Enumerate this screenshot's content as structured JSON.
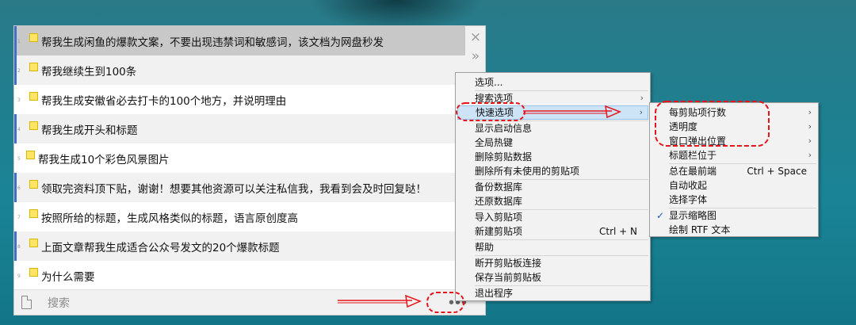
{
  "clip_items": [
    {
      "index": "1",
      "text": "帮我生成闲鱼的爆款文案，不要出现违禁词和敏感词，该文档为网盘秒发"
    },
    {
      "index": "2",
      "text": "帮我继续生到100条"
    },
    {
      "index": "3",
      "text": "帮我生成安徽省必去打卡的100个地方，并说明理由"
    },
    {
      "index": "4",
      "text": "帮我生成开头和标题"
    },
    {
      "index": "5",
      "text": "帮我生成10个彩色风景图片"
    },
    {
      "index": "6",
      "text": "领取完资料顶下贴，谢谢！想要其他资源可以关注私信我，我看到会及时回复哒！"
    },
    {
      "index": "7",
      "text": "按照所给的标题，生成风格类似的标题，语言原创度高"
    },
    {
      "index": "8",
      "text": "上面文章帮我生成适合公众号发文的20个爆款标题"
    },
    {
      "index": "9",
      "text": "为什么需要"
    }
  ],
  "panel_icons": {
    "close": "×",
    "expand": "»",
    "more": "•••"
  },
  "search": {
    "placeholder": "搜索"
  },
  "main_menu": {
    "options": "选项...",
    "search_options": "搜索选项",
    "quick_options": "快速选项",
    "show_startup": "显示启动信息",
    "global_hotkey": "全局热键",
    "delete_clip": "删除剪贴数据",
    "delete_unused": "删除所有未使用的剪贴项",
    "backup_db": "备份数据库",
    "restore_db": "还原数据库",
    "import_clip": "导入剪贴项",
    "new_clip": "新建剪贴项",
    "new_clip_shortcut": "Ctrl + N",
    "help": "帮助",
    "disconnect": "断开剪贴板连接",
    "save_current": "保存当前剪贴板",
    "exit": "退出程序"
  },
  "submenu": {
    "lines_per_clip": "每剪贴项行数",
    "transparency": "透明度",
    "window_position": "窗口弹出位置",
    "caption_position": "标题栏位于",
    "always_on_top": "总在最前端",
    "always_on_top_shortcut": "Ctrl + Space",
    "auto_hide": "自动收起",
    "choose_font": "选择字体",
    "show_thumbnails": "显示缩略图",
    "draw_rtf": "绘制 RTF 文本"
  },
  "glyphs": {
    "arrow": "›",
    "check": "✓"
  },
  "colors": {
    "annotation_red": "#e8141c",
    "highlight": "#cde4f7",
    "row_bar": "#3d6fc7",
    "note_yellow": "#ffe566"
  }
}
